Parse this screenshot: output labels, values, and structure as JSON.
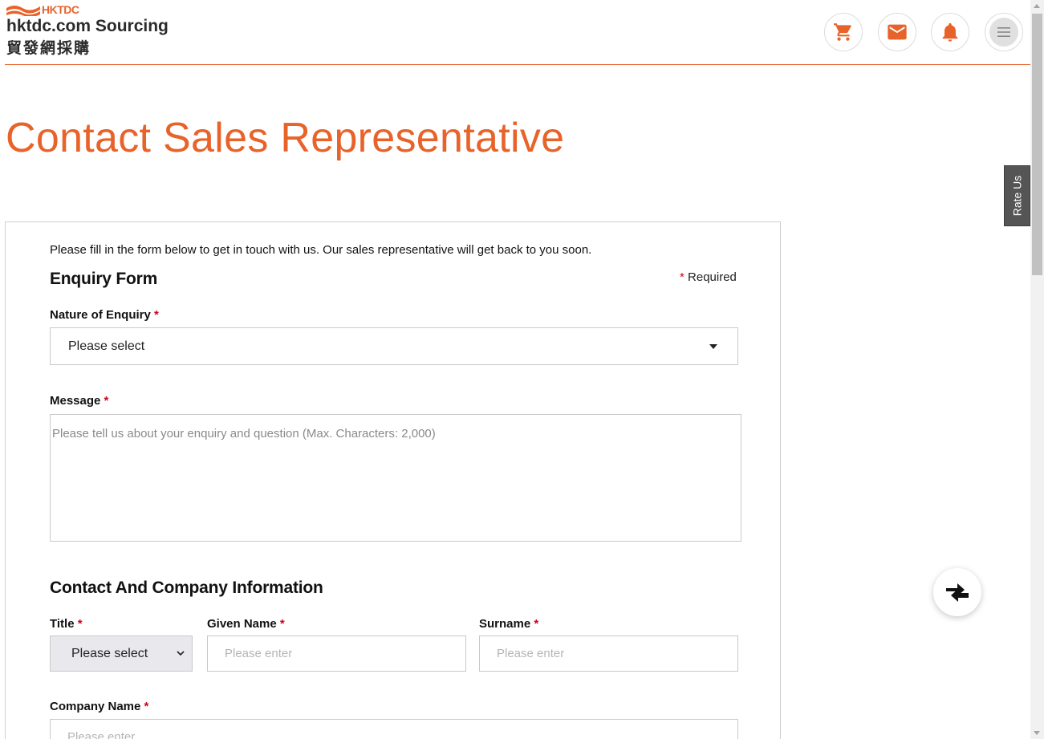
{
  "header": {
    "logo_brand": "HKTDC",
    "logo_title": "hktdc.com Sourcing",
    "logo_cn": "貿發網採購",
    "accent_color": "#e8632a",
    "icons": [
      "cart-icon",
      "mail-icon",
      "bell-icon",
      "menu-icon"
    ]
  },
  "rate_us": "Rate Us",
  "page_title": "Contact Sales Representative",
  "form": {
    "intro": "Please fill in the form below to get in touch with us. Our sales representative will get back to you soon.",
    "enquiry_heading": "Enquiry Form",
    "required_star": "*",
    "required_note": "Required",
    "nature_label": "Nature of Enquiry",
    "nature_value": "Please select",
    "message_label": "Message",
    "message_placeholder": "Please tell us about your enquiry and question (Max. Characters: 2,000)",
    "contact_heading": "Contact And Company Information",
    "title_label": "Title",
    "title_value": "Please select",
    "given_name_label": "Given Name",
    "given_name_placeholder": "Please enter",
    "surname_label": "Surname",
    "surname_placeholder": "Please enter",
    "company_label": "Company Name",
    "company_placeholder": "Please enter"
  }
}
